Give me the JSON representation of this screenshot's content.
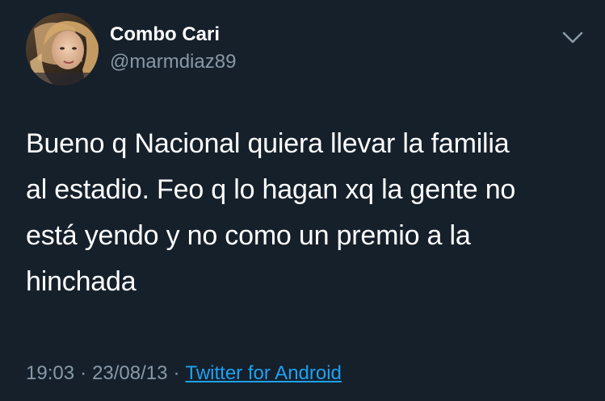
{
  "tweet": {
    "author": {
      "display_name": "Combo Cari",
      "handle": "@marmdiaz89"
    },
    "text_lines": [
      "Bueno q Nacional quiera llevar la familia",
      "al estadio. Feo q lo hagan xq la gente no",
      "está yendo y no como un premio a la",
      "hinchada"
    ],
    "time": "19:03",
    "date": "23/08/13",
    "separator": "·",
    "source": "Twitter for Android"
  },
  "icons": {
    "menu": "chevron-down-icon"
  },
  "colors": {
    "background": "#15202b",
    "primary_text": "#ffffff",
    "secondary_text": "#8899a6",
    "link": "#1da1f2"
  }
}
